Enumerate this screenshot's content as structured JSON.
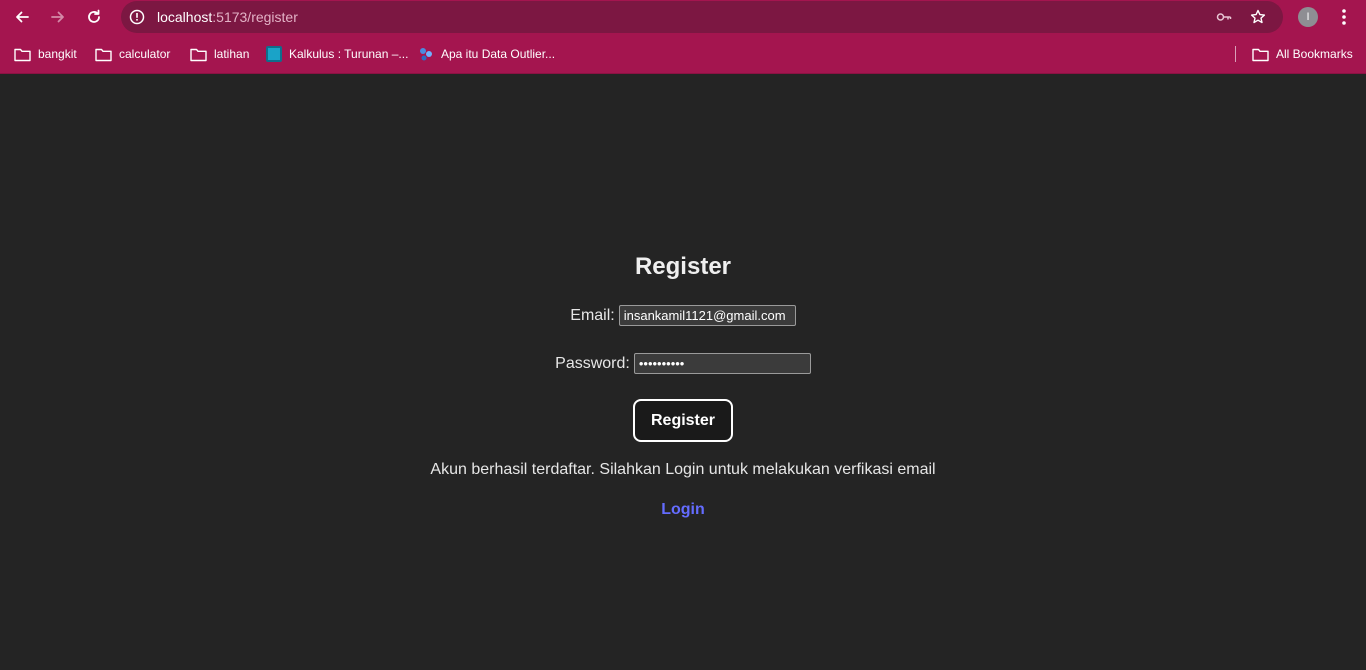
{
  "browser": {
    "url_host": "localhost",
    "url_path": ":5173/register",
    "profile_initial": "I",
    "bookmarks": [
      {
        "label": "bangkit",
        "icon": "folder-icon"
      },
      {
        "label": "calculator",
        "icon": "folder-icon"
      },
      {
        "label": "latihan",
        "icon": "folder-icon"
      },
      {
        "label": "Kalkulus : Turunan –...",
        "icon": "site-favicon"
      },
      {
        "label": "Apa itu Data Outlier...",
        "icon": "site-favicon"
      }
    ],
    "all_bookmarks_label": "All Bookmarks",
    "theme_color": "#a4154f"
  },
  "form": {
    "title": "Register",
    "email_label": "Email:",
    "email_value": "insankamil1121@gmail.com",
    "password_label": "Password:",
    "password_value": "••••••••••",
    "submit_label": "Register",
    "message": "Akun berhasil terdaftar. Silahkan Login untuk melakukan verfikasi email",
    "login_link": "Login",
    "link_color": "#646cff"
  }
}
